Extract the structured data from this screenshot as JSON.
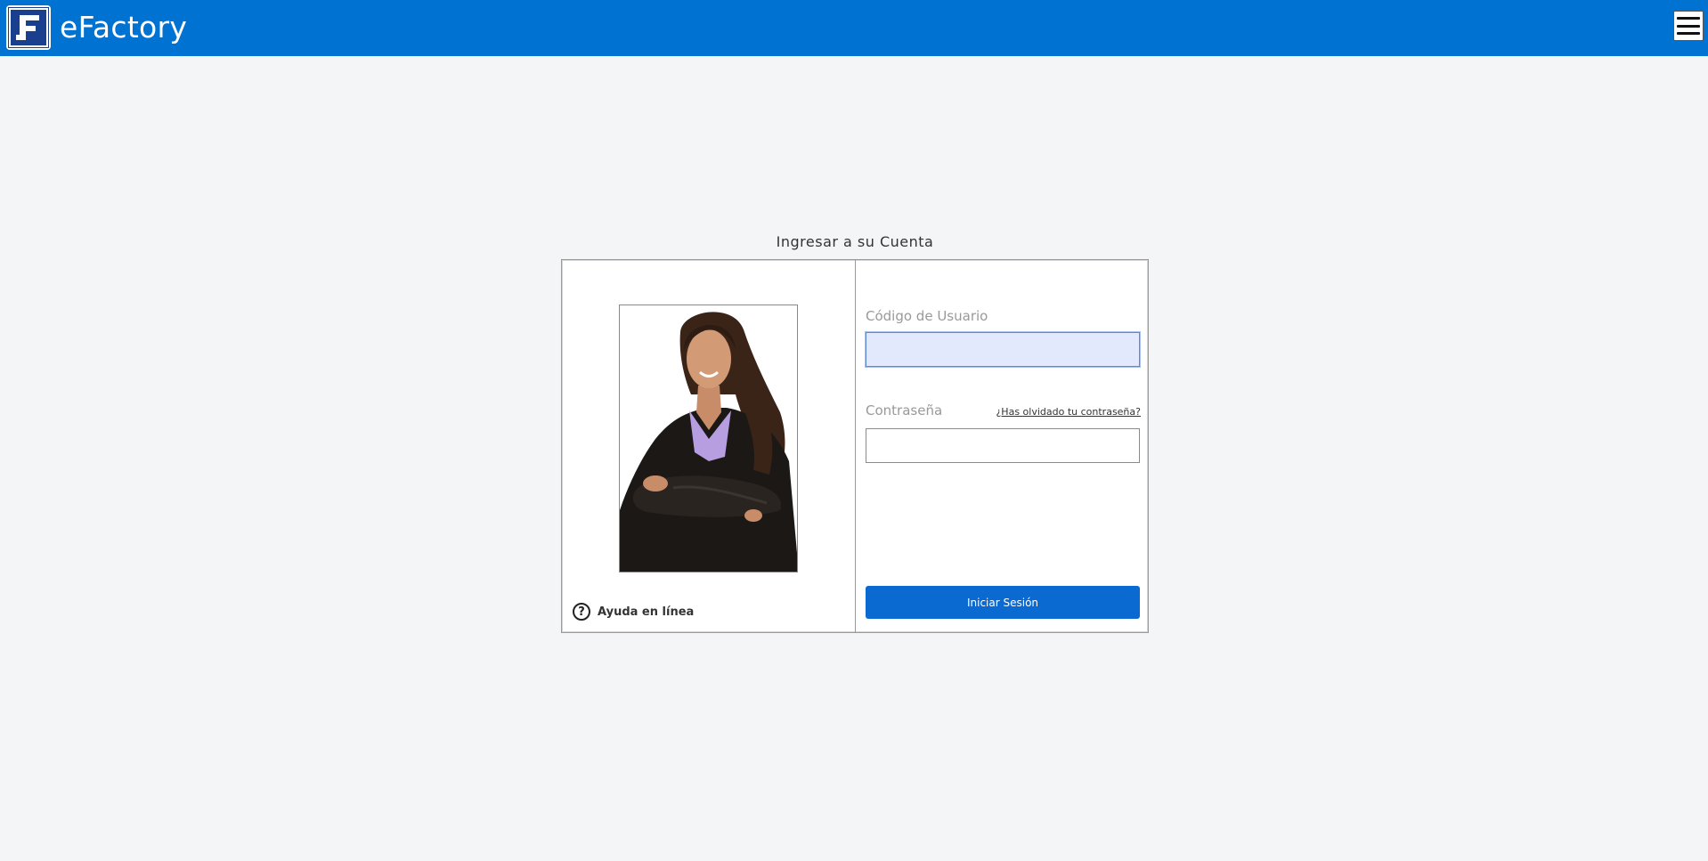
{
  "header": {
    "app_title": "eFactory",
    "logo_icon": "efactory-logo-icon",
    "menu_icon": "hamburger-menu-icon",
    "bar_color": "#0072d2"
  },
  "login": {
    "heading": "Ingresar a su Cuenta",
    "username": {
      "label": "Código de Usuario",
      "value": ""
    },
    "password": {
      "label": "Contraseña",
      "value": "",
      "forgot_link": "¿Has olvidado tu contraseña?"
    },
    "submit_label": "Iniciar Sesión",
    "help": {
      "label": "Ayuda en línea",
      "icon": "question-circle-icon"
    },
    "photo": "businesswoman-photo",
    "button_color": "#0a6ad2"
  }
}
